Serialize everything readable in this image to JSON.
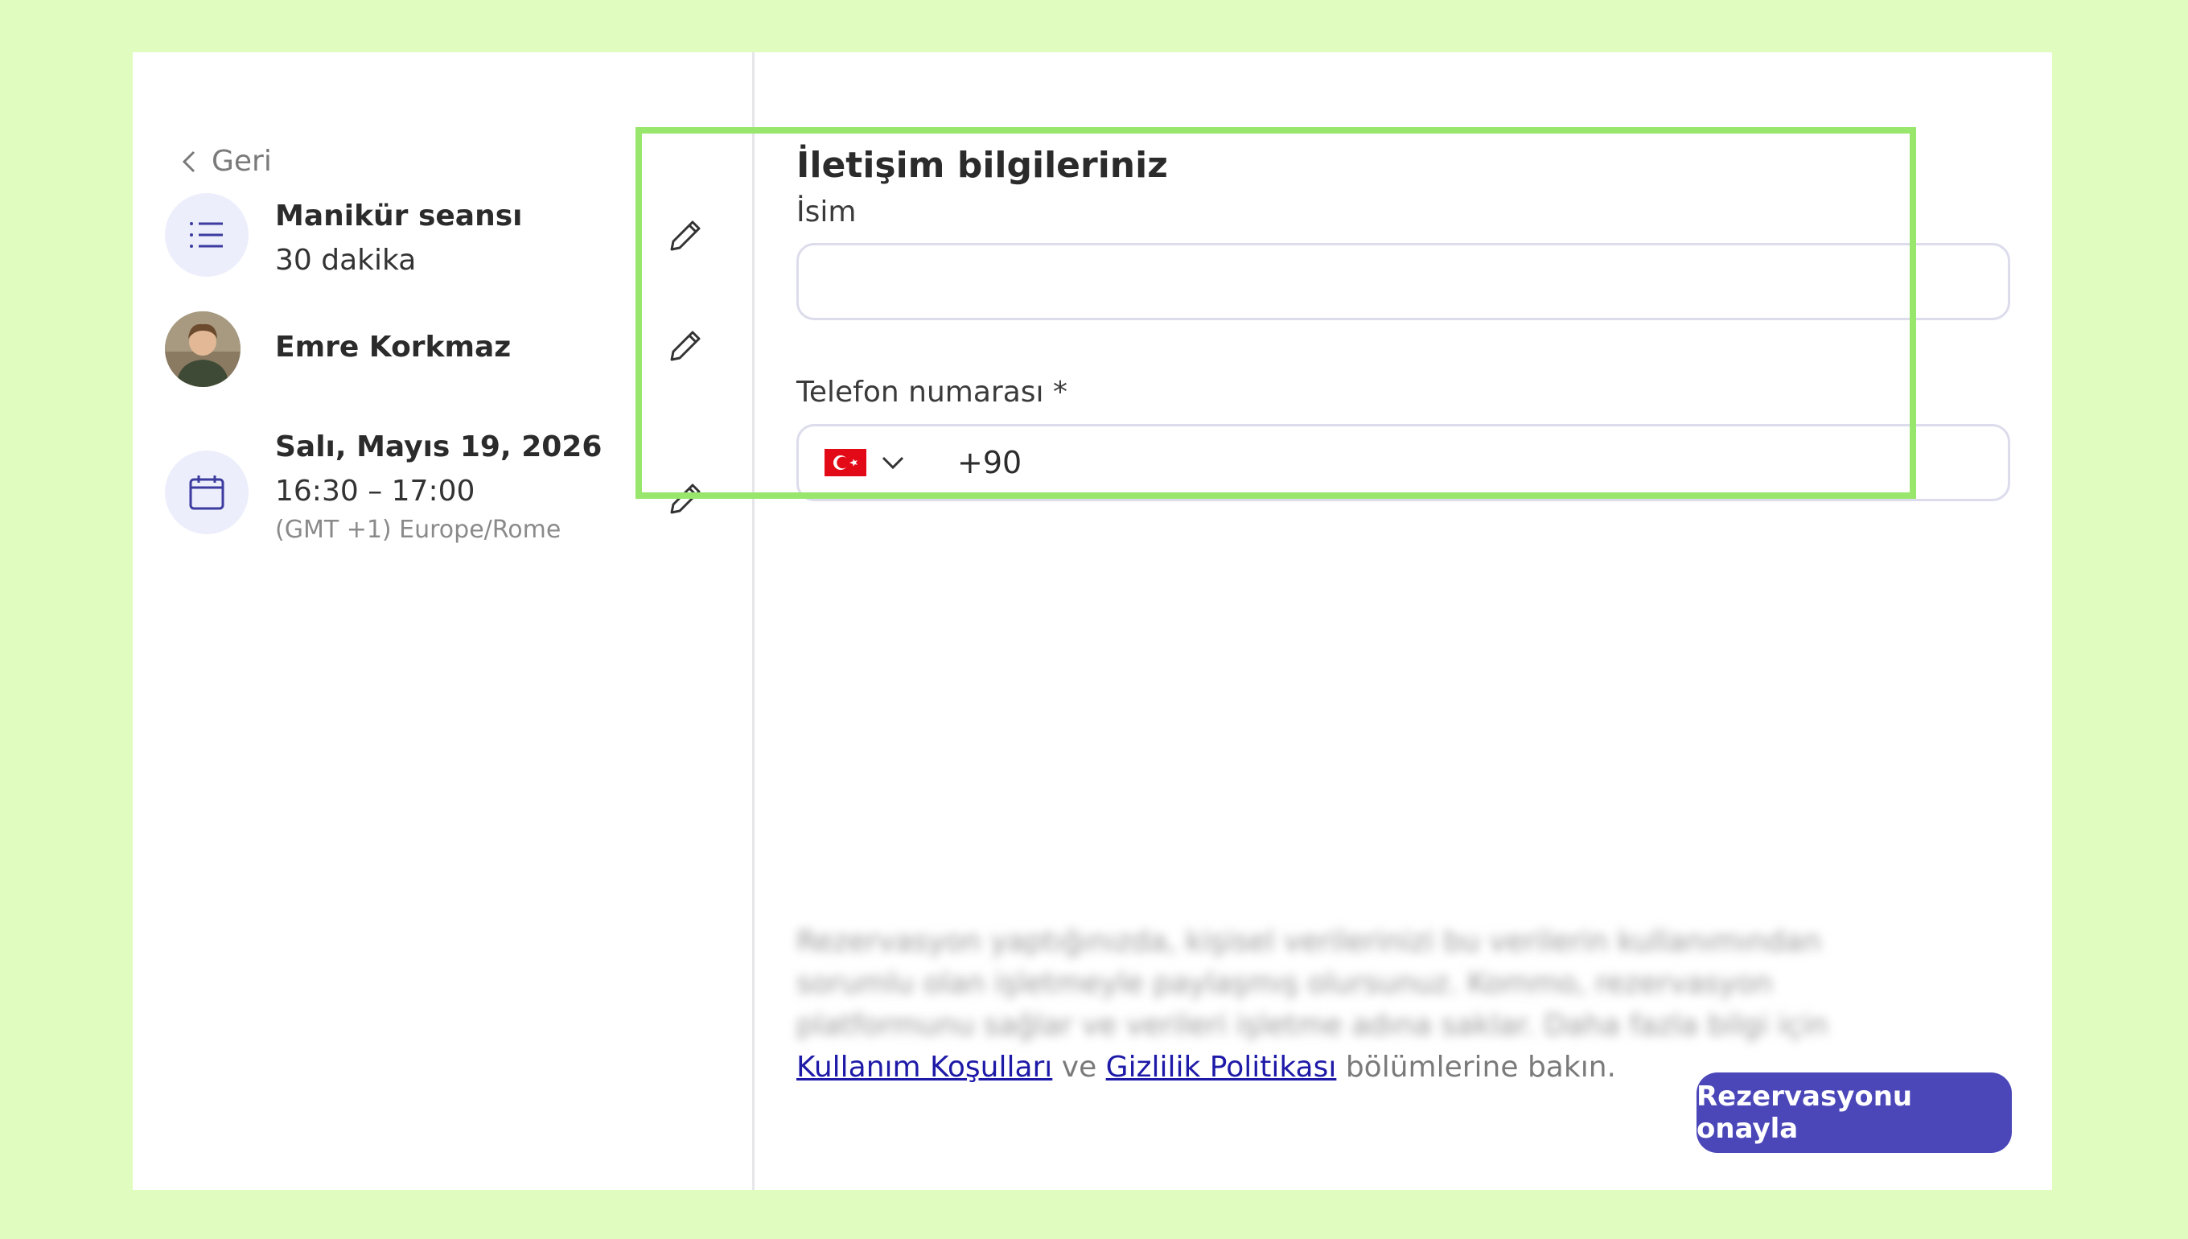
{
  "nav": {
    "back_label": "Geri"
  },
  "summary": {
    "service": {
      "title": "Manikür seansı",
      "duration": "30 dakika"
    },
    "staff": {
      "name": "Emre Korkmaz"
    },
    "datetime": {
      "date": "Salı, Mayıs 19, 2026",
      "time": "16:30 – 17:00",
      "timezone": "(GMT +1) Europe/Rome"
    }
  },
  "form": {
    "heading": "İletişim bilgileriniz",
    "name_label": "İsim",
    "name_value": "",
    "phone_label": "Telefon numarası *",
    "phone_country_code": "+90",
    "phone_country_icon": "turkey-flag-icon"
  },
  "disclaimer": {
    "blurred_text": "Rezervasyon yaptığınızda, kişisel verilerinizi bu verilerin kullanımından sorumlu olan işletmeyle paylaşmış olursunuz. Kommo, rezervasyon platformunu sağlar ve verileri işletme adına saklar. Daha fazla bilgi için",
    "terms_link": "Kullanım Koşulları",
    "connector": "ve",
    "privacy_link": "Gizlilik Politikası",
    "suffix": "bölümlerine bakın."
  },
  "actions": {
    "confirm_label": "Rezervasyonu onayla"
  },
  "colors": {
    "background": "#e0fcbe",
    "primary": "#4b47b9",
    "highlight": "#98e66c",
    "link": "#1e1aa8"
  }
}
